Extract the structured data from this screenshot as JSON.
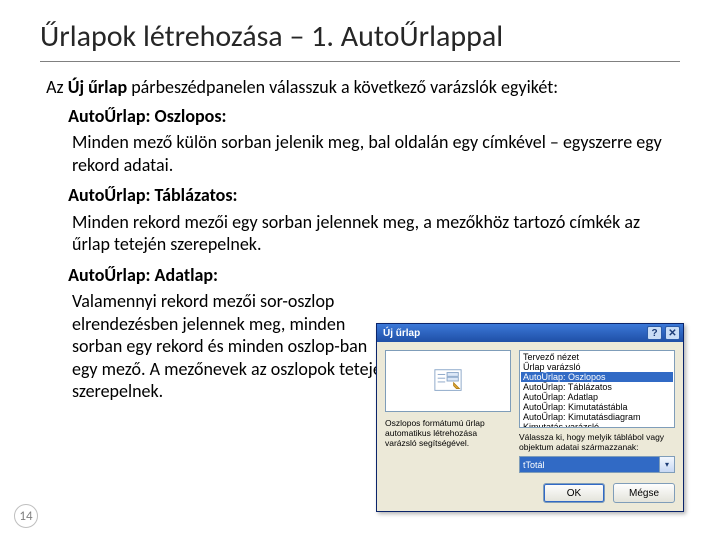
{
  "page_number": "14",
  "title": "Űrlapok létrehozása – 1. AutoŰrlappal",
  "bullet_glyph": "໾",
  "intro": {
    "pre": "Az ",
    "bold": "Új űrlap",
    "post": " párbeszédpanelen válasszuk a következő varázslók egyikét:"
  },
  "items": [
    {
      "label_pre": "AutoŰrlap: ",
      "label_bold": "Oszlopos:",
      "desc": "Minden mező külön sorban jelenik meg, bal oldalán egy címkével – egyszerre egy rekord adatai."
    },
    {
      "label_pre": "AutoŰrlap: ",
      "label_bold": "Táblázatos:",
      "desc": "Minden rekord mezői egy sorban jelennek meg, a mezőkhöz tartozó címkék az űrlap tetején szerepelnek."
    },
    {
      "label_pre": "AutoŰrlap: ",
      "label_bold": "Adatlap:",
      "desc": "Valamennyi rekord mezői sor-oszlop elrendezésben jelennek meg, minden sorban egy rekord és minden oszlop-ban egy mező. A mezőnevek az oszlopok tetején szerepelnek."
    }
  ],
  "dialog": {
    "title": "Új űrlap",
    "help_glyph": "?",
    "close_glyph": "✕",
    "list": [
      "Tervező nézet",
      "Űrlap varázsló",
      "AutoŰrlap: Oszlopos",
      "AutoŰrlap: Táblázatos",
      "AutoŰrlap: Adatlap",
      "AutoŰrlap: Kimutatástábla",
      "AutoŰrlap: Kimutatásdiagram",
      "Kimutatás varázsló"
    ],
    "selected_index": 2,
    "desc": "Oszlopos formátumú űrlap automatikus létrehozása varázsló segítségével.",
    "source_label": "Válassza ki, hogy melyik táblábol vagy objektum adatai származzanak:",
    "combo_value": "tTotál",
    "combo_arrow": "▾",
    "ok": "OK",
    "cancel": "Mégse"
  }
}
